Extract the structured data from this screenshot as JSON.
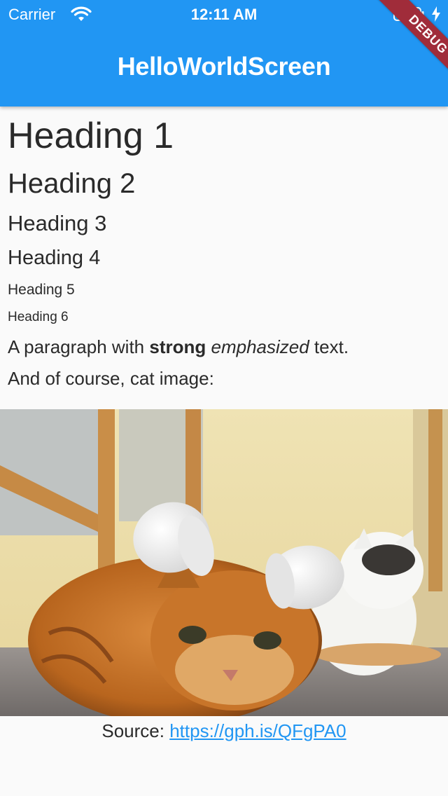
{
  "status_bar": {
    "carrier": "Carrier",
    "time": "12:11 AM"
  },
  "app_bar": {
    "title": "HelloWorldScreen",
    "debug_banner": "DEBUG",
    "color": "#2196f3"
  },
  "content": {
    "heading1": "Heading 1",
    "heading2": "Heading 2",
    "heading3": "Heading 3",
    "heading4": "Heading 4",
    "heading5": "Heading 5",
    "heading6": "Heading 6",
    "paragraph": {
      "prefix": "A paragraph with ",
      "strong": "strong",
      "space": " ",
      "emphasized": "emphasized",
      "suffix": " text."
    },
    "cat_intro": "And of course, cat image:",
    "source": {
      "label": "Source: ",
      "link_text": "https://gph.is/QFgPA0"
    }
  }
}
